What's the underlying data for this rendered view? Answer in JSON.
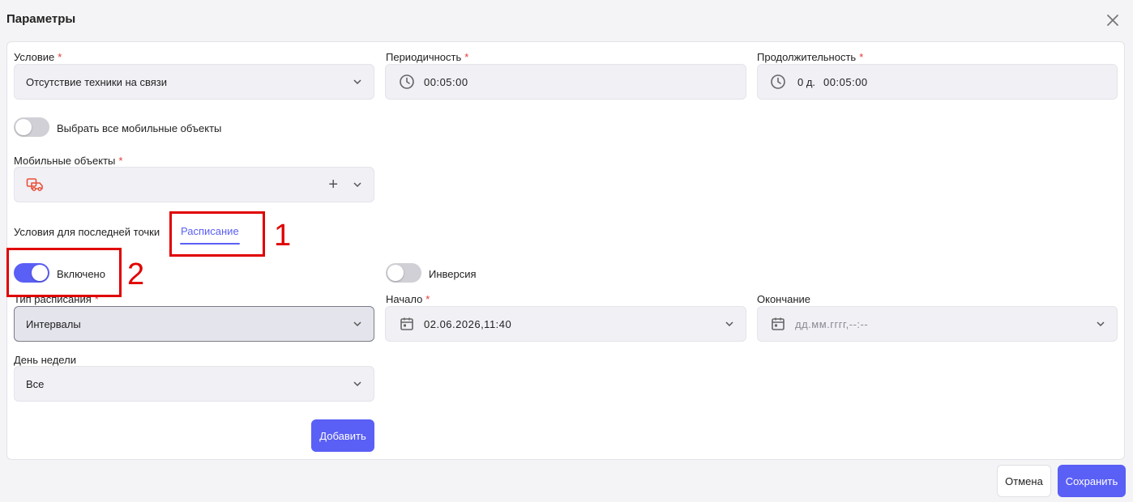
{
  "dialog": {
    "title": "Параметры"
  },
  "condition": {
    "label": "Условие",
    "required_mark": "*",
    "value": "Отсутствие техники на связи"
  },
  "periodicity": {
    "label": "Периодичность",
    "required_mark": "*",
    "value": "00:05:00"
  },
  "duration": {
    "label": "Продолжительность",
    "required_mark": "*",
    "days": "0 д.",
    "value": "00:05:00"
  },
  "select_all": {
    "label": "Выбрать все мобильные объекты",
    "enabled": false
  },
  "mobile_objects": {
    "label": "Мобильные объекты",
    "required_mark": "*",
    "add_glyph": "+"
  },
  "tabs": {
    "static_label": "Условия для последней точки",
    "active_label": "Расписание"
  },
  "enabled_toggle": {
    "label": "Включено",
    "enabled": true
  },
  "inversion_toggle": {
    "label": "Инверсия",
    "enabled": false
  },
  "schedule_type": {
    "label": "Тип расписания",
    "required_mark": "*",
    "value": "Интервалы"
  },
  "start": {
    "label": "Начало",
    "required_mark": "*",
    "value": "02.06.2026,11:40"
  },
  "end": {
    "label": "Окончание",
    "placeholder": "дд.мм.гггг,--:--"
  },
  "weekday": {
    "label": "День недели",
    "value": "Все"
  },
  "buttons": {
    "add": "Добавить",
    "cancel": "Отмена",
    "save": "Сохранить"
  },
  "annotations": {
    "box1_number": "1",
    "box2_number": "2"
  },
  "colors": {
    "accent": "#5a5ff5",
    "required": "#e53935",
    "annotation": "#e00000",
    "vehicle_icon": "#e8503a"
  }
}
